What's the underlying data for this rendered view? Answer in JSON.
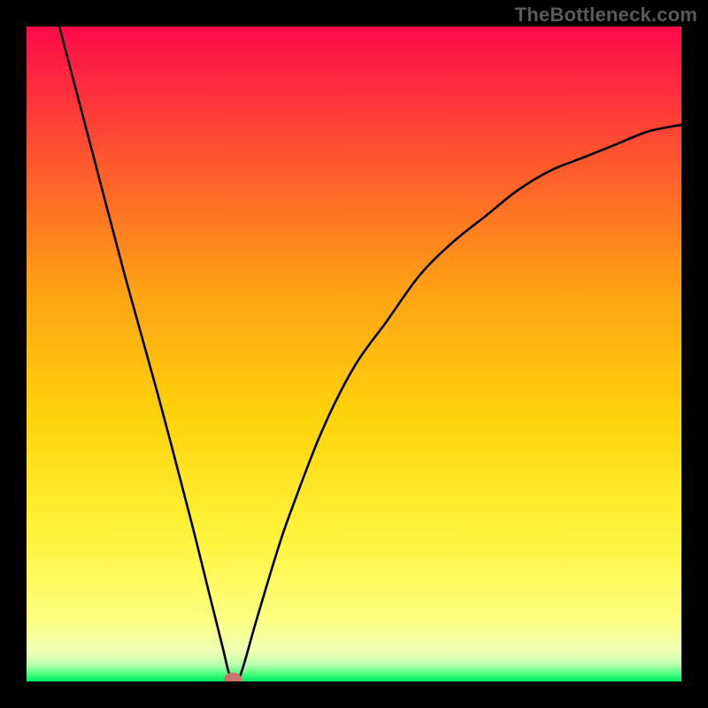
{
  "watermark": "TheBottleneck.com",
  "chart_data": {
    "type": "line",
    "title": "",
    "xlabel": "",
    "ylabel": "",
    "xlim": [
      0,
      100
    ],
    "ylim": [
      0,
      100
    ],
    "x": [
      5,
      10,
      15,
      20,
      25,
      28,
      30,
      31,
      32,
      33,
      35,
      38,
      40,
      45,
      50,
      55,
      60,
      65,
      70,
      75,
      80,
      85,
      90,
      95,
      100
    ],
    "values": [
      100,
      81,
      62,
      44,
      25,
      13,
      5,
      1,
      0,
      2,
      9,
      19,
      25,
      38,
      48,
      55,
      62,
      67,
      71,
      75,
      78,
      80,
      82,
      84,
      85
    ],
    "marker": {
      "x": 31.5,
      "y": 0
    },
    "gradient_stops": [
      {
        "offset": 0,
        "color": "#ff0a4a"
      },
      {
        "offset": 0.15,
        "color": "#ff4236"
      },
      {
        "offset": 0.4,
        "color": "#ffa114"
      },
      {
        "offset": 0.6,
        "color": "#ffd40b"
      },
      {
        "offset": 0.78,
        "color": "#fff43c"
      },
      {
        "offset": 0.9,
        "color": "#fdff7d"
      },
      {
        "offset": 0.955,
        "color": "#f0ffb4"
      },
      {
        "offset": 0.975,
        "color": "#b7ffb0"
      },
      {
        "offset": 0.99,
        "color": "#3fff77"
      },
      {
        "offset": 1.0,
        "color": "#00e765"
      }
    ]
  }
}
